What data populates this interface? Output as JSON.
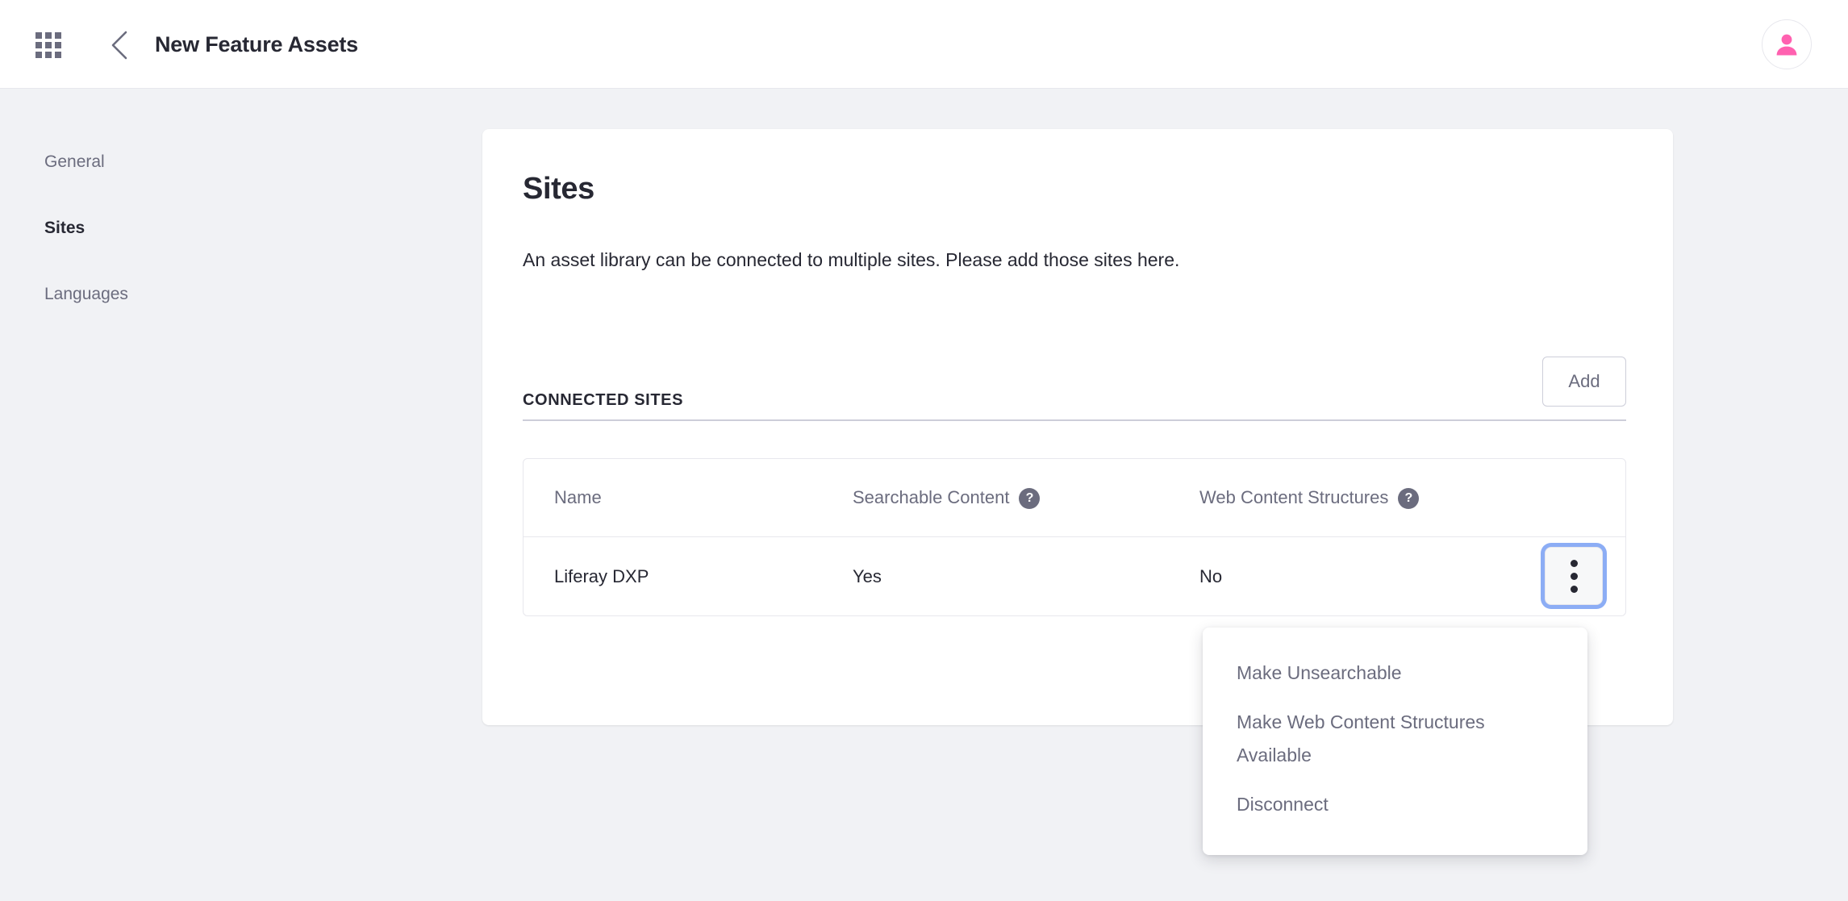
{
  "header": {
    "title": "New Feature Assets",
    "app_grid_icon": "grid-icon",
    "back_icon": "chevron-left-icon",
    "avatar_icon": "user-avatar-icon",
    "avatar_color": "#ff61b0"
  },
  "sidebar": {
    "items": [
      {
        "label": "General",
        "active": false
      },
      {
        "label": "Sites",
        "active": true
      },
      {
        "label": "Languages",
        "active": false
      }
    ]
  },
  "main": {
    "title": "Sites",
    "description": "An asset library can be connected to multiple sites. Please add those sites here.",
    "connected_sites_label": "CONNECTED SITES",
    "add_button": "Add",
    "table": {
      "columns": [
        {
          "label": "Name",
          "help": false
        },
        {
          "label": "Searchable Content",
          "help": true,
          "help_glyph": "?"
        },
        {
          "label": "Web Content Structures",
          "help": true,
          "help_glyph": "?"
        }
      ],
      "rows": [
        {
          "name": "Liferay DXP",
          "searchable_content": "Yes",
          "web_content_structures": "No"
        }
      ]
    },
    "row_actions_icon": "kebab-menu-icon"
  },
  "dropdown": {
    "visible": true,
    "items": [
      {
        "label": "Make Unsearchable"
      },
      {
        "label": "Make Web Content Structures Available"
      },
      {
        "label": "Disconnect"
      }
    ]
  },
  "colors": {
    "page_background": "#f1f2f5",
    "card_background": "#ffffff",
    "text_primary": "#272833",
    "text_secondary": "#6b6c7e",
    "border": "#e7e7ed",
    "focus_ring": "#8cadf5",
    "accent_pink": "#ff61b0"
  }
}
